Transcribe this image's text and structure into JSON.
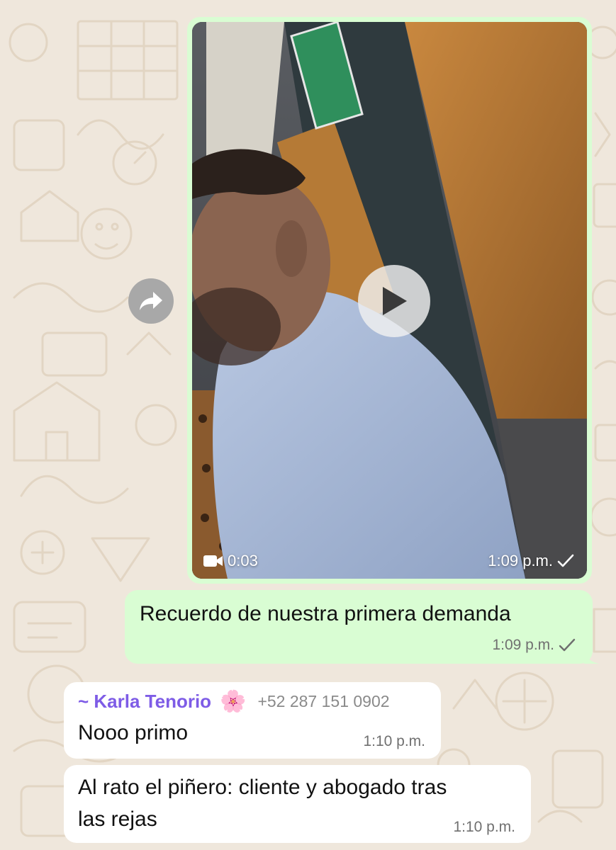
{
  "messages": {
    "video": {
      "duration": "0:03",
      "time": "1:09 p.m."
    },
    "outgoing": {
      "text": "Recuerdo de nuestra primera demanda",
      "time": "1:09 p.m."
    },
    "incoming": [
      {
        "sender_name": "~ Karla Tenorio",
        "sender_emoji": "🌸",
        "sender_phone": "+52 287 151 0902",
        "text": "Nooo primo",
        "time": "1:10 p.m."
      },
      {
        "text_line1": "Al rato el piñero: cliente y abogado tras",
        "text_line2": "las rejas",
        "time": "1:10 p.m."
      }
    ]
  },
  "colors": {
    "outgoing_bubble": "#d9fdd3",
    "incoming_bubble": "#ffffff",
    "sender_name": "#7e5ce6",
    "wallpaper": "#efe7dc"
  },
  "icons": {
    "forward": "forward-arrow-icon",
    "play": "play-icon",
    "video_camera": "video-camera-icon",
    "sent_check": "single-check-icon"
  }
}
